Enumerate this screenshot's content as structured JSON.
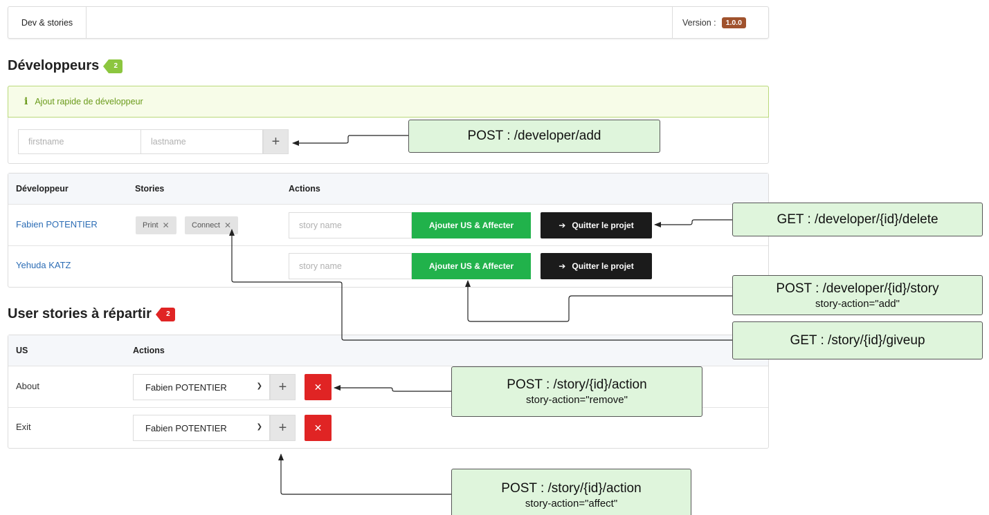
{
  "navbar": {
    "brand": "Dev & stories",
    "version_label": "Version :",
    "version": "1.0.0"
  },
  "developers_section": {
    "title": "Développeurs",
    "count": "2",
    "quick_add": {
      "header": "Ajout rapide de développeur",
      "firstname_placeholder": "firstname",
      "lastname_placeholder": "lastname",
      "add_symbol": "+"
    },
    "table": {
      "headers": [
        "Développeur",
        "Stories",
        "Actions"
      ],
      "rows": [
        {
          "name": "Fabien POTENTIER",
          "stories": [
            "Print",
            "Connect"
          ],
          "story_placeholder": "story name",
          "add_button": "Ajouter US & Affecter",
          "quit_button": "Quitter le projet"
        },
        {
          "name": "Yehuda KATZ",
          "stories": [],
          "story_placeholder": "story name",
          "add_button": "Ajouter US & Affecter",
          "quit_button": "Quitter le projet"
        }
      ]
    }
  },
  "stories_section": {
    "title": "User stories à répartir",
    "count": "2",
    "table": {
      "headers": [
        "US",
        "Actions"
      ],
      "rows": [
        {
          "us": "About",
          "selected_developer": "Fabien POTENTIER",
          "add_symbol": "+",
          "remove_symbol": "✕"
        },
        {
          "us": "Exit",
          "selected_developer": "Fabien POTENTIER",
          "add_symbol": "+",
          "remove_symbol": "✕"
        }
      ]
    }
  },
  "annotations": {
    "developer_add": {
      "line1": "POST :  /developer/add"
    },
    "developer_delete": {
      "line1": "GET :  /developer/{id}/delete"
    },
    "developer_story": {
      "line1": "POST :  /developer/{id}/story",
      "line2": "story-action=\"add\""
    },
    "story_giveup": {
      "line1": "GET :  /story/{id}/giveup"
    },
    "story_remove": {
      "line1": "POST :  /story/{id}/action",
      "line2": "story-action=\"remove\""
    },
    "story_affect": {
      "line1": "POST :  /story/{id}/action",
      "line2": "story-action=\"affect\""
    }
  },
  "colors": {
    "accent_green": "#21b24b",
    "danger_red": "#e02424",
    "version_badge": "#a0522d",
    "annotation_fill": "#dff5dc"
  }
}
